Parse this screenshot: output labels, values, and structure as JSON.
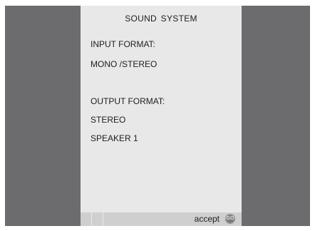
{
  "title": "SOUND  SYSTEM",
  "input": {
    "heading": "INPUT FORMAT:",
    "value": "MONO /STEREO"
  },
  "output": {
    "heading": "OUTPUT FORMAT:",
    "value": "STEREO",
    "speaker": "SPEAKER 1"
  },
  "statusbar": {
    "accept_label": "accept",
    "go_label": "GO",
    "go_icon": "go-button-icon"
  },
  "colors": {
    "background": "#6c6c6e",
    "panel": "#e8e8e8",
    "statusbar": "#cfcfcf",
    "text": "#1e1e1e"
  }
}
